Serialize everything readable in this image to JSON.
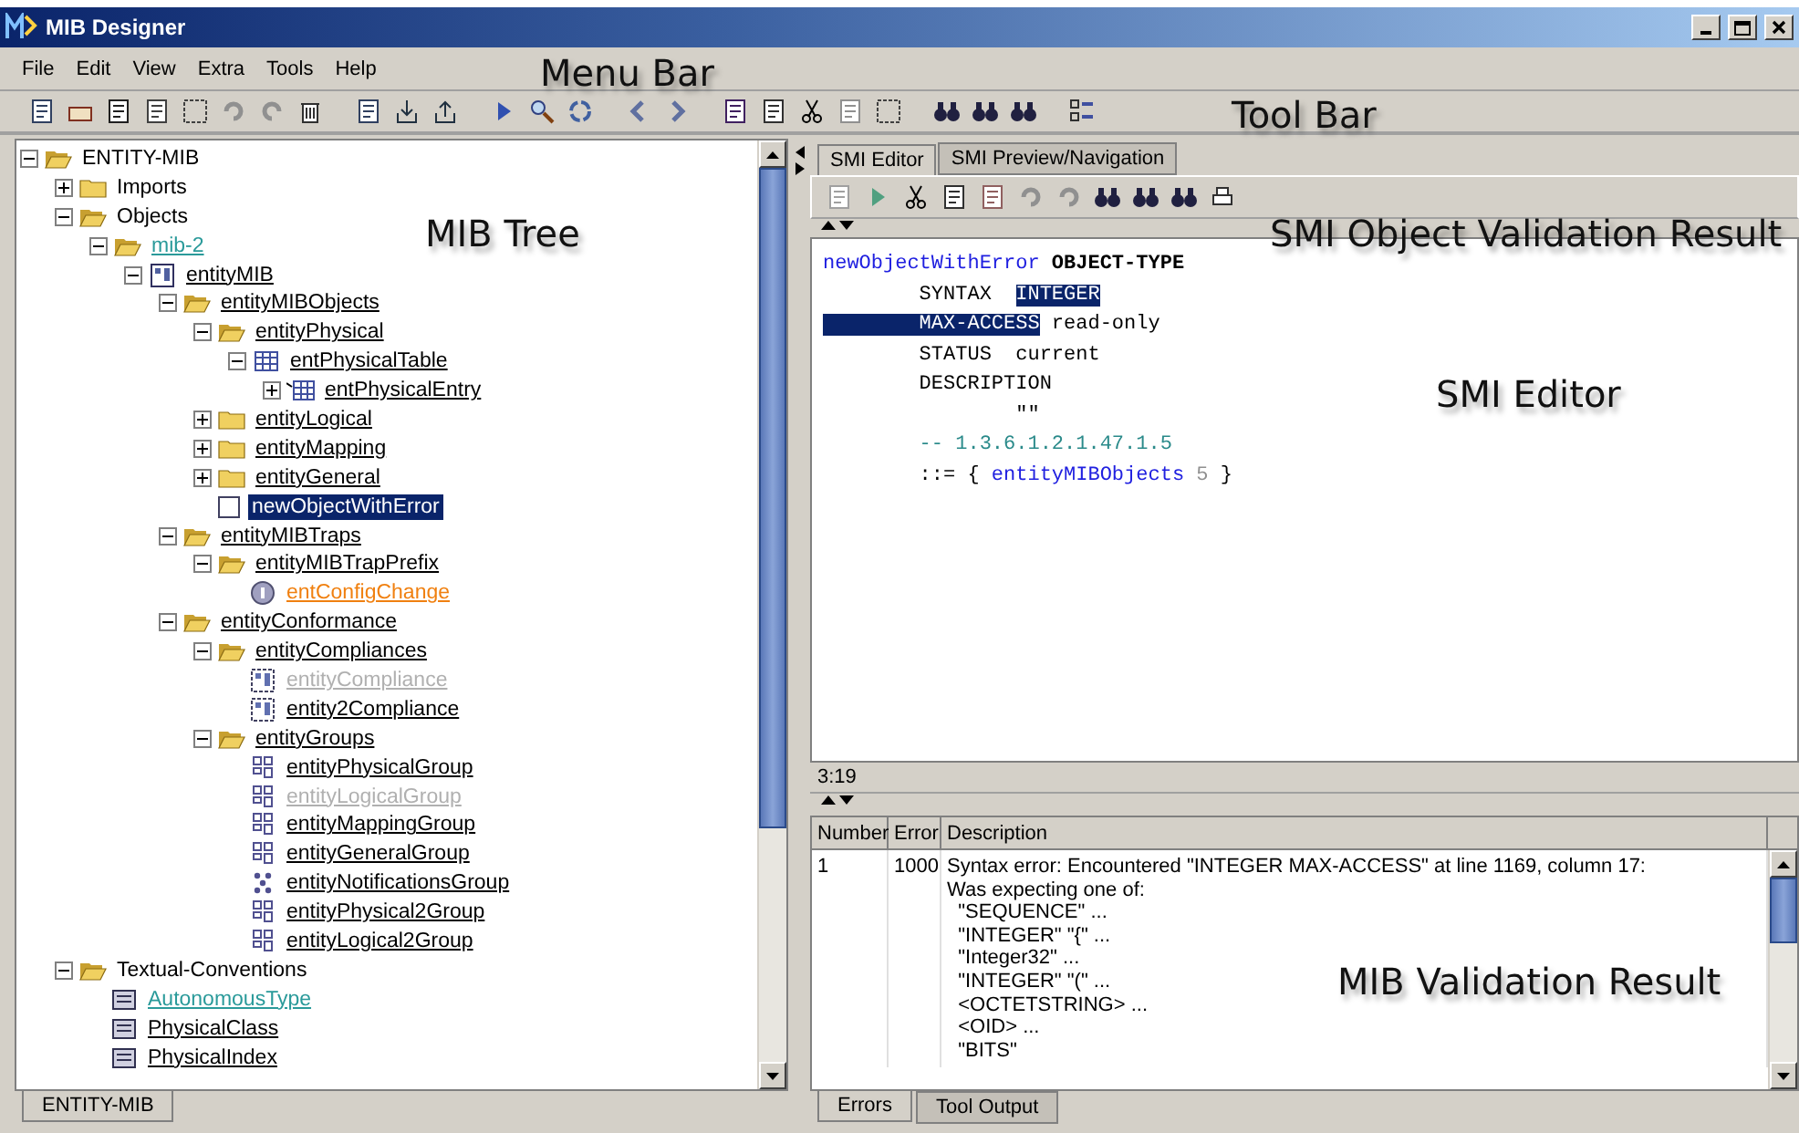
{
  "window": {
    "title": "MIB Designer"
  },
  "menu": [
    "File",
    "Edit",
    "View",
    "Extra",
    "Tools",
    "Help"
  ],
  "tree": {
    "root": {
      "label": "ENTITY-MIB",
      "kind": "section",
      "color": "#000000",
      "expanded": true,
      "selected": false,
      "disabled": false,
      "children": [
        {
          "label": "Imports",
          "kind": "section",
          "color": "#000000",
          "expanded": false,
          "selected": false,
          "disabled": false
        },
        {
          "label": "Objects",
          "kind": "section",
          "color": "#000000",
          "expanded": true,
          "selected": false,
          "disabled": false,
          "children": [
            {
              "label": "mib-2",
              "kind": "folder",
              "color": "#2a9a9a",
              "expanded": true,
              "selected": false,
              "disabled": false,
              "children": [
                {
                  "label": "entityMIB",
                  "kind": "module",
                  "color": "#000000",
                  "expanded": true,
                  "selected": false,
                  "disabled": false,
                  "children": [
                    {
                      "label": "entityMIBObjects",
                      "kind": "folder",
                      "color": "#000000",
                      "expanded": true,
                      "selected": false,
                      "disabled": false,
                      "children": [
                        {
                          "label": "entityPhysical",
                          "kind": "folder",
                          "color": "#000000",
                          "expanded": true,
                          "selected": false,
                          "disabled": false,
                          "children": [
                            {
                              "label": "entPhysicalTable",
                              "kind": "table",
                              "color": "#000000",
                              "expanded": true,
                              "selected": false,
                              "disabled": false,
                              "children": [
                                {
                                  "label": "entPhysicalEntry",
                                  "kind": "entry",
                                  "color": "#000000",
                                  "expanded": false,
                                  "selected": false,
                                  "disabled": false
                                }
                              ]
                            }
                          ]
                        },
                        {
                          "label": "entityLogical",
                          "kind": "folder",
                          "color": "#000000",
                          "expanded": false,
                          "selected": false,
                          "disabled": false
                        },
                        {
                          "label": "entityMapping",
                          "kind": "folder",
                          "color": "#000000",
                          "expanded": false,
                          "selected": false,
                          "disabled": false
                        },
                        {
                          "label": "entityGeneral",
                          "kind": "folder",
                          "color": "#000000",
                          "expanded": false,
                          "selected": false,
                          "disabled": false
                        },
                        {
                          "label": "newObjectWithError",
                          "kind": "leaf",
                          "selected": true,
                          "disabled": false
                        }
                      ]
                    },
                    {
                      "label": "entityMIBTraps",
                      "kind": "folder",
                      "color": "#000000",
                      "expanded": true,
                      "selected": false,
                      "disabled": false,
                      "children": [
                        {
                          "label": "entityMIBTrapPrefix",
                          "kind": "folder",
                          "color": "#000000",
                          "expanded": true,
                          "selected": false,
                          "disabled": false,
                          "children": [
                            {
                              "label": "entConfigChange",
                              "kind": "notification",
                              "color": "#f08010",
                              "selected": false,
                              "disabled": false
                            }
                          ]
                        }
                      ]
                    },
                    {
                      "label": "entityConformance",
                      "kind": "folder",
                      "color": "#000000",
                      "expanded": true,
                      "selected": false,
                      "disabled": false,
                      "children": [
                        {
                          "label": "entityCompliances",
                          "kind": "folder",
                          "color": "#000000",
                          "expanded": true,
                          "selected": false,
                          "disabled": false,
                          "children": [
                            {
                              "label": "entityCompliance",
                              "kind": "compliance",
                              "selected": false,
                              "disabled": true
                            },
                            {
                              "label": "entity2Compliance",
                              "kind": "compliance",
                              "color": "#000000",
                              "selected": false,
                              "disabled": false
                            }
                          ]
                        },
                        {
                          "label": "entityGroups",
                          "kind": "folder",
                          "color": "#000000",
                          "expanded": true,
                          "selected": false,
                          "disabled": false,
                          "children": [
                            {
                              "label": "entityPhysicalGroup",
                              "kind": "group",
                              "color": "#000000",
                              "selected": false,
                              "disabled": false
                            },
                            {
                              "label": "entityLogicalGroup",
                              "kind": "group",
                              "selected": false,
                              "disabled": true
                            },
                            {
                              "label": "entityMappingGroup",
                              "kind": "group",
                              "color": "#000000",
                              "selected": false,
                              "disabled": false
                            },
                            {
                              "label": "entityGeneralGroup",
                              "kind": "group",
                              "color": "#000000",
                              "selected": false,
                              "disabled": false
                            },
                            {
                              "label": "entityNotificationsGroup",
                              "kind": "notificationgroup",
                              "color": "#000000",
                              "selected": false,
                              "disabled": false
                            },
                            {
                              "label": "entityPhysical2Group",
                              "kind": "group",
                              "color": "#000000",
                              "selected": false,
                              "disabled": false
                            },
                            {
                              "label": "entityLogical2Group",
                              "kind": "group",
                              "color": "#000000",
                              "selected": false,
                              "disabled": false
                            }
                          ]
                        }
                      ]
                    }
                  ]
                }
              ]
            }
          ]
        },
        {
          "label": "Textual-Conventions",
          "kind": "section",
          "color": "#000000",
          "expanded": true,
          "selected": false,
          "disabled": false,
          "children": [
            {
              "label": "AutonomousType",
              "kind": "convention",
              "color": "#2a9a9a",
              "selected": false,
              "disabled": false
            },
            {
              "label": "PhysicalClass",
              "kind": "convention",
              "color": "#000000",
              "selected": false,
              "disabled": false
            },
            {
              "label": "PhysicalIndex",
              "kind": "convention",
              "color": "#000000",
              "selected": false,
              "disabled": false
            }
          ]
        }
      ]
    },
    "tabs": [
      {
        "label": "ENTITY-MIB",
        "selected": true
      }
    ]
  },
  "editor_tabs": [
    {
      "label": "SMI Editor",
      "selected": true
    },
    {
      "label": "SMI Preview/Navigation",
      "selected": false
    }
  ],
  "code": [
    [
      {
        "text": "newObjectWithError",
        "kind": "ident",
        "highlight": false
      },
      {
        "text": " OBJECT-TYPE",
        "kind": "keyword",
        "highlight": false
      }
    ],
    [
      {
        "text": "        SYNTAX  ",
        "kind": "plain",
        "highlight": false
      },
      {
        "text": "INTEGER",
        "kind": "plain",
        "highlight": true
      }
    ],
    [
      {
        "text": "        MAX-ACCESS",
        "kind": "plain",
        "highlight": true
      },
      {
        "text": " read-only",
        "kind": "plain",
        "highlight": false
      }
    ],
    [
      {
        "text": "        STATUS  current",
        "kind": "plain",
        "highlight": false
      }
    ],
    [
      {
        "text": "        DESCRIPTION",
        "kind": "plain",
        "highlight": false
      }
    ],
    [
      {
        "text": "                \"\"",
        "kind": "plain",
        "highlight": false
      }
    ],
    [
      {
        "text": "        -- 1.3.6.1.2.1.47.1.5",
        "kind": "comment",
        "highlight": false
      }
    ],
    [
      {
        "text": "        ::= { ",
        "kind": "plain",
        "highlight": false
      },
      {
        "text": "entityMIBObjects",
        "kind": "ident",
        "highlight": false
      },
      {
        "text": " 5",
        "kind": "number",
        "highlight": false
      },
      {
        "text": " }",
        "kind": "plain",
        "highlight": false
      }
    ]
  ],
  "cursor_position": "3:19",
  "errors": {
    "columns": [
      "Number",
      "Error",
      "Description"
    ],
    "rows": [
      {
        "number": "1",
        "error": "1000",
        "description": [
          "Syntax error: Encountered \"INTEGER MAX-ACCESS\" at line 1169, column 17:",
          "Was expecting one of:",
          "  \"SEQUENCE\" ...",
          "  \"INTEGER\" \"{\" ...",
          "  \"Integer32\" ...",
          "  \"INTEGER\" \"(\" ...",
          "  <OCTETSTRING> ...",
          "  <OID> ...",
          "  \"BITS\""
        ]
      }
    ]
  },
  "result_tabs": [
    {
      "label": "Errors",
      "selected": true
    },
    {
      "label": "Tool Output",
      "selected": false
    }
  ],
  "annotations": [
    "Menu Bar",
    "Tool Bar",
    "MIB Tree",
    "SMI Object Validation Result",
    "SMI Editor",
    "MIB Validation Result"
  ]
}
